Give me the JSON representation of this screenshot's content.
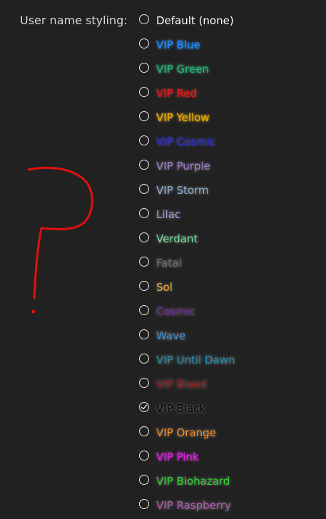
{
  "setting": {
    "label": "User name styling:"
  },
  "options": [
    {
      "label": "Default (none)",
      "color": "#ffffff",
      "checked": false,
      "effect": "none"
    },
    {
      "label": "VIP Blue",
      "color": "#1e90ff",
      "checked": false,
      "effect": "sparkle"
    },
    {
      "label": "VIP Green",
      "color": "#22b573",
      "checked": false,
      "effect": "sparkle"
    },
    {
      "label": "VIP Red",
      "color": "#e81919",
      "checked": false,
      "effect": "sparkle"
    },
    {
      "label": "VIP Yellow",
      "color": "#f6b100",
      "checked": false,
      "effect": "sparkle"
    },
    {
      "label": "VIP Cosmic",
      "color": "#2f2fd6",
      "checked": false,
      "effect": "sparkle"
    },
    {
      "label": "VIP Purple",
      "color": "#a77bdb",
      "checked": false,
      "effect": "glow"
    },
    {
      "label": "VIP Storm",
      "color": "#8fb0d6",
      "checked": false,
      "effect": "glow"
    },
    {
      "label": "Lilac",
      "color": "#a99be6",
      "checked": false,
      "effect": "glow"
    },
    {
      "label": "Verdant",
      "color": "#6fe39b",
      "checked": false,
      "effect": "glow"
    },
    {
      "label": "Fatal",
      "color": "#6e6e6e",
      "checked": false,
      "effect": "glow"
    },
    {
      "label": "Sol",
      "color": "#f4b227",
      "checked": false,
      "effect": "glow"
    },
    {
      "label": "Cosmic",
      "color": "#7a1fb0",
      "checked": false,
      "effect": "glow"
    },
    {
      "label": "Wave",
      "color": "#3d8fd9",
      "checked": false,
      "effect": "glow"
    },
    {
      "label": "VIP Until Dawn",
      "color": "#1a8fb3",
      "checked": false,
      "effect": "glow"
    },
    {
      "label": "VIP Blood",
      "color": "#8e0e0e",
      "checked": false,
      "effect": "glow"
    },
    {
      "label": "VIP Black",
      "color": "#000000",
      "checked": true,
      "effect": "glow"
    },
    {
      "label": "VIP Orange",
      "color": "#ff8c1a",
      "checked": false,
      "effect": "glow"
    },
    {
      "label": "VIP Pink",
      "color": "#e21de2",
      "checked": false,
      "effect": "sparkle"
    },
    {
      "label": "VIP Biohazard",
      "color": "#2bd92b",
      "checked": false,
      "effect": "glow"
    },
    {
      "label": "VIP Raspberry",
      "color": "#b45ab4",
      "checked": false,
      "effect": "glow"
    }
  ],
  "annotation": {
    "name": "question-mark-scribble",
    "color": "#e01010"
  }
}
